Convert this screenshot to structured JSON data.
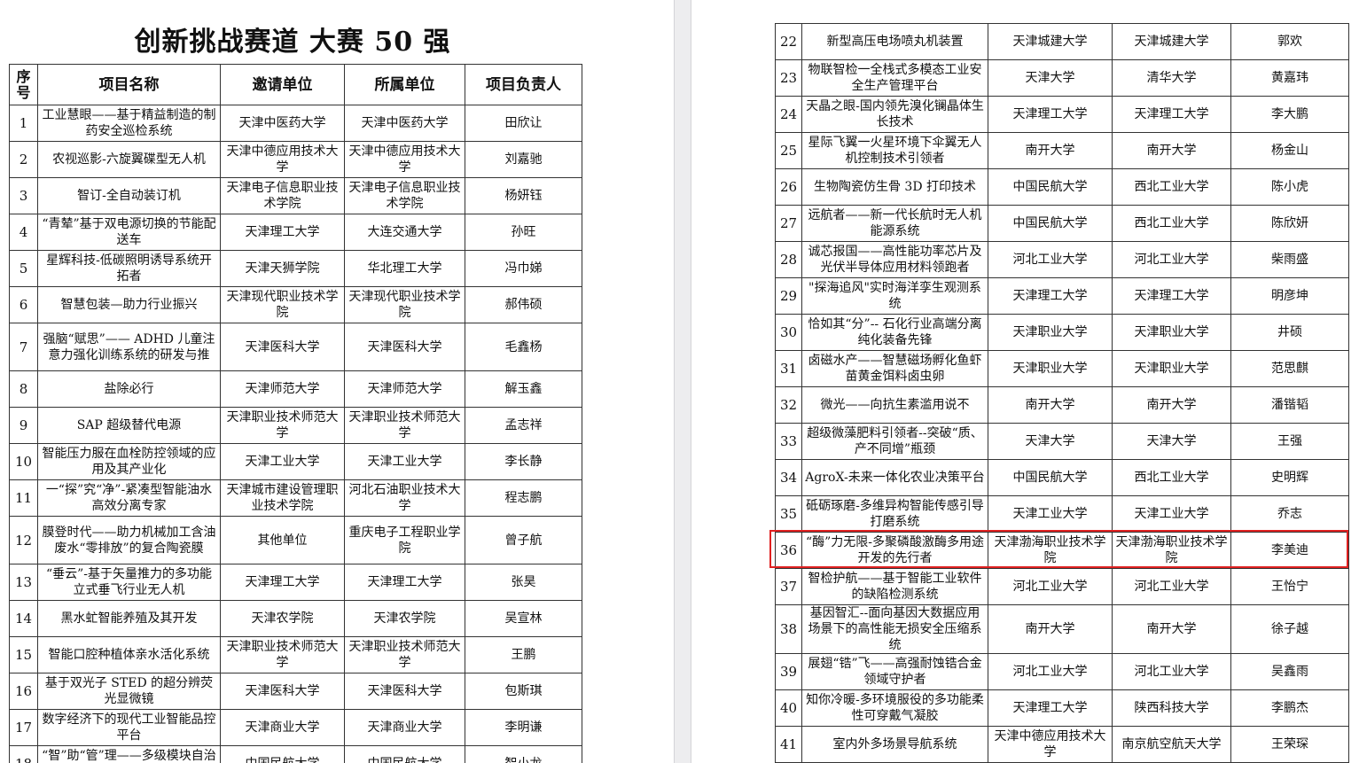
{
  "doc_title": "创新挑战赛道  大赛 50 强",
  "headers": {
    "no": "序号",
    "name": "项目名称",
    "inviter": "邀请单位",
    "affiliation": "所属单位",
    "leader": "项目负责人"
  },
  "left_rows": [
    {
      "no": "1",
      "name": "工业慧眼——基于精益制造的制药安全巡检系统",
      "inviter": "天津中医药大学",
      "affiliation": "天津中医药大学",
      "leader": "田欣让"
    },
    {
      "no": "2",
      "name": "农视巡影-六旋翼碟型无人机",
      "inviter": "天津中德应用技术大学",
      "affiliation": "天津中德应用技术大学",
      "leader": "刘嘉驰"
    },
    {
      "no": "3",
      "name": "智订-全自动装订机",
      "inviter": "天津电子信息职业技术学院",
      "affiliation": "天津电子信息职业技术学院",
      "leader": "杨妍钰"
    },
    {
      "no": "4",
      "name": "“青辇”基于双电源切换的节能配送车",
      "inviter": "天津理工大学",
      "affiliation": "大连交通大学",
      "leader": "孙旺"
    },
    {
      "no": "5",
      "name": "星辉科技-低碳照明诱导系统开拓者",
      "inviter": "天津天狮学院",
      "affiliation": "华北理工大学",
      "leader": "冯巾娣"
    },
    {
      "no": "6",
      "name": "智慧包装—助力行业振兴",
      "inviter": "天津现代职业技术学院",
      "affiliation": "天津现代职业技术学院",
      "leader": "郝伟硕"
    },
    {
      "no": "7",
      "name": "强脑“赋思”—— ADHD 儿童注意力强化训练系统的研发与推",
      "inviter": "天津医科大学",
      "affiliation": "天津医科大学",
      "leader": "毛鑫杨"
    },
    {
      "no": "8",
      "name": "盐除必行",
      "inviter": "天津师范大学",
      "affiliation": "天津师范大学",
      "leader": "解玉鑫"
    },
    {
      "no": "9",
      "name": "SAP 超级替代电源",
      "inviter": "天津职业技术师范大学",
      "affiliation": "天津职业技术师范大学",
      "leader": "孟志祥"
    },
    {
      "no": "10",
      "name": "智能压力服在血栓防控领域的应用及其产业化",
      "inviter": "天津工业大学",
      "affiliation": "天津工业大学",
      "leader": "李长静"
    },
    {
      "no": "11",
      "name": "一“探”究“净”-紧凑型智能油水高效分离专家",
      "inviter": "天津城市建设管理职业技术学院",
      "affiliation": "河北石油职业技术大学",
      "leader": "程志鹏"
    },
    {
      "no": "12",
      "name": "膜登时代——助力机械加工含油废水“零排放”的复合陶瓷膜",
      "inviter": "其他单位",
      "affiliation": "重庆电子工程职业学院",
      "leader": "曾子航"
    },
    {
      "no": "13",
      "name": "“垂云”-基于矢量推力的多功能立式垂飞行业无人机",
      "inviter": "天津理工大学",
      "affiliation": "天津理工大学",
      "leader": "张昊"
    },
    {
      "no": "14",
      "name": "黑水虻智能养殖及其开发",
      "inviter": "天津农学院",
      "affiliation": "天津农学院",
      "leader": "吴宣林"
    },
    {
      "no": "15",
      "name": "智能口腔种植体亲水活化系统",
      "inviter": "天津职业技术师范大学",
      "affiliation": "天津职业技术师范大学",
      "leader": "王鹏"
    },
    {
      "no": "16",
      "name": "基于双光子 STED 的超分辨荧光显微镜",
      "inviter": "天津医科大学",
      "affiliation": "天津医科大学",
      "leader": "包斯琪"
    },
    {
      "no": "17",
      "name": "数字经济下的现代工业智能品控平台",
      "inviter": "天津商业大学",
      "affiliation": "天津商业大学",
      "leader": "李明谦"
    },
    {
      "no": "18",
      "name": "“智”助“管”理——多级模块自治化音赛管理一体式服务",
      "inviter": "中国民航大学",
      "affiliation": "中国民航大学",
      "leader": "智小龙"
    }
  ],
  "right_rows": [
    {
      "no": "22",
      "name": "新型高压电场喷丸机装置",
      "inviter": "天津城建大学",
      "affiliation": "天津城建大学",
      "leader": "郭欢"
    },
    {
      "no": "23",
      "name": "物联智检一全栈式多模态工业安全生产管理平台",
      "inviter": "天津大学",
      "affiliation": "清华大学",
      "leader": "黄嘉玮"
    },
    {
      "no": "24",
      "name": "天晶之眼-国内领先溴化镧晶体生长技术",
      "inviter": "天津理工大学",
      "affiliation": "天津理工大学",
      "leader": "李大鹏"
    },
    {
      "no": "25",
      "name": "星际飞翼一火星环境下伞翼无人机控制技术引领者",
      "inviter": "南开大学",
      "affiliation": "南开大学",
      "leader": "杨金山"
    },
    {
      "no": "26",
      "name": "生物陶瓷仿生骨 3D 打印技术",
      "inviter": "中国民航大学",
      "affiliation": "西北工业大学",
      "leader": "陈小虎"
    },
    {
      "no": "27",
      "name": "远航者——新一代长航时无人机能源系统",
      "inviter": "中国民航大学",
      "affiliation": "西北工业大学",
      "leader": "陈欣妍"
    },
    {
      "no": "28",
      "name": "诚芯报国——高性能功率芯片及光伏半导体应用材料领跑者",
      "inviter": "河北工业大学",
      "affiliation": "河北工业大学",
      "leader": "柴雨盛"
    },
    {
      "no": "29",
      "name": "\"探海追风\"实时海洋孪生观测系统",
      "inviter": "天津理工大学",
      "affiliation": "天津理工大学",
      "leader": "明彦坤"
    },
    {
      "no": "30",
      "name": "恰如其“分”-- 石化行业高端分离纯化装备先锋",
      "inviter": "天津职业大学",
      "affiliation": "天津职业大学",
      "leader": "井硕"
    },
    {
      "no": "31",
      "name": "卤磁水产——智慧磁场孵化鱼虾苗黄金饵料卤虫卵",
      "inviter": "天津职业大学",
      "affiliation": "天津职业大学",
      "leader": "范思麒"
    },
    {
      "no": "32",
      "name": "微光——向抗生素滥用说不",
      "inviter": "南开大学",
      "affiliation": "南开大学",
      "leader": "潘锴韬"
    },
    {
      "no": "33",
      "name": "超级微藻肥料引领者--突破“质、产不同增”瓶颈",
      "inviter": "天津大学",
      "affiliation": "天津大学",
      "leader": "王强"
    },
    {
      "no": "34",
      "name": "AgroX-未来一体化农业决策平台",
      "inviter": "中国民航大学",
      "affiliation": "西北工业大学",
      "leader": "史明辉"
    },
    {
      "no": "35",
      "name": "砥砺琢磨-多维异构智能传感引导打磨系统",
      "inviter": "天津工业大学",
      "affiliation": "天津工业大学",
      "leader": "乔志"
    },
    {
      "no": "36",
      "name": "“酶”力无限-多聚磷酸激酶多用途开发的先行者",
      "inviter": "天津渤海职业技术学院",
      "affiliation": "天津渤海职业技术学院",
      "leader": "李美迪"
    },
    {
      "no": "37",
      "name": "智检护航——基于智能工业软件的缺陷检测系统",
      "inviter": "河北工业大学",
      "affiliation": "河北工业大学",
      "leader": "王怡宁"
    },
    {
      "no": "38",
      "name": "基因智汇--面向基因大数据应用场景下的高性能无损安全压缩系统",
      "inviter": "南开大学",
      "affiliation": "南开大学",
      "leader": "徐子越"
    },
    {
      "no": "39",
      "name": "展翅“锆”飞——高强耐蚀锆合金领域守护者",
      "inviter": "河北工业大学",
      "affiliation": "河北工业大学",
      "leader": "吴鑫雨"
    },
    {
      "no": "40",
      "name": "知你冷暖-多环境服役的多功能柔性可穿戴气凝胶",
      "inviter": "天津理工大学",
      "affiliation": "陕西科技大学",
      "leader": "李鹏杰"
    },
    {
      "no": "41",
      "name": "室内外多场景导航系统",
      "inviter": "天津中德应用技术大学",
      "affiliation": "南京航空航天大学",
      "leader": "王荣琛"
    }
  ],
  "highlighted_row_no": "36"
}
